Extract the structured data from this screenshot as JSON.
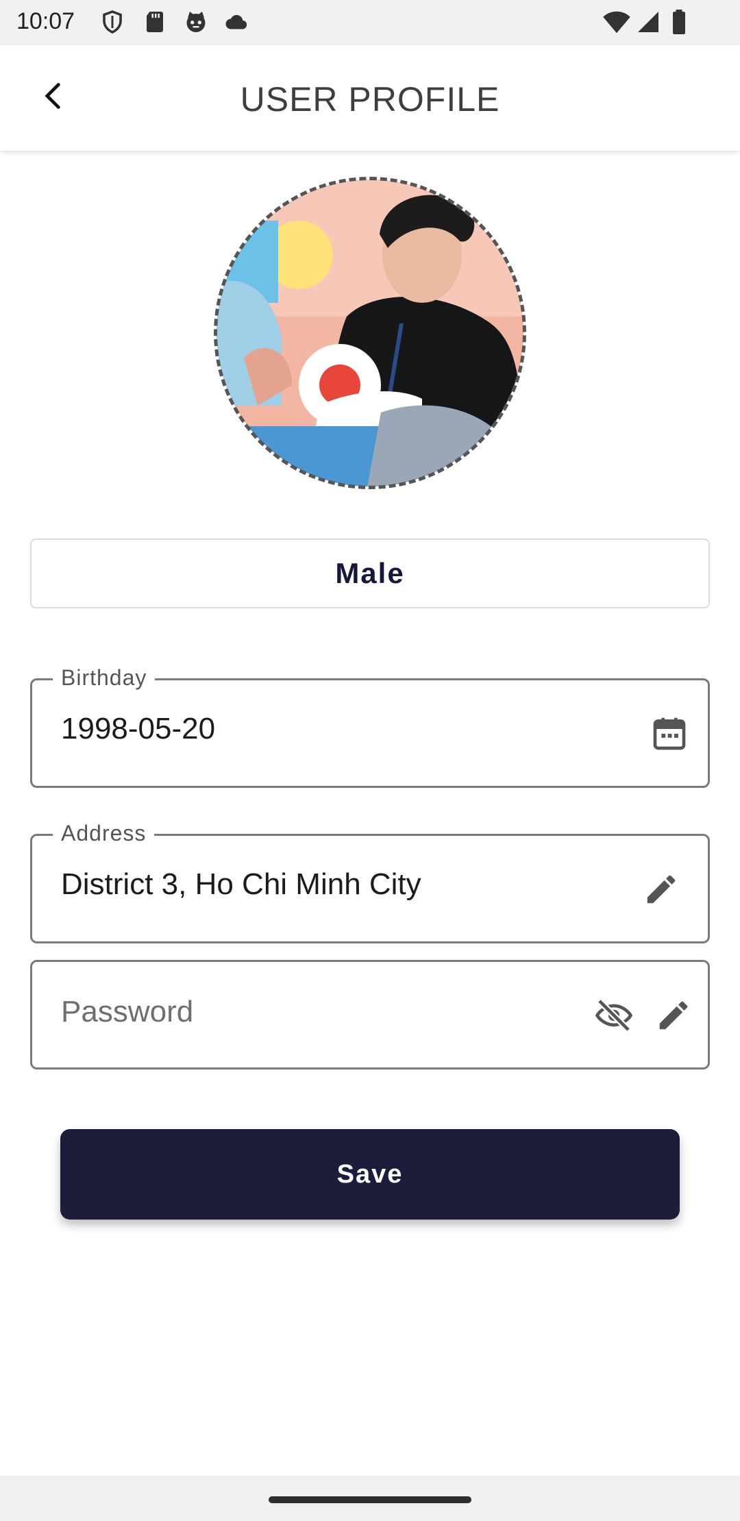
{
  "status_bar": {
    "time": "10:07",
    "left_icons": [
      "shield-icon",
      "sd-card-icon",
      "cat-face-icon",
      "cloud-icon"
    ],
    "right_icons": [
      "wifi-icon",
      "signal-icon",
      "battery-icon"
    ]
  },
  "app_bar": {
    "title": "USER PROFILE",
    "back_icon": "chevron-left-icon"
  },
  "profile": {
    "gender": "Male"
  },
  "fields": {
    "birthday": {
      "label": "Birthday",
      "value": "1998-05-20",
      "icon": "calendar-icon"
    },
    "address": {
      "label": "Address",
      "value": "District 3, Ho Chi Minh City",
      "icon": "pencil-icon"
    },
    "password": {
      "placeholder": "Password",
      "icons": [
        "eye-off-icon",
        "pencil-icon"
      ]
    }
  },
  "actions": {
    "save_label": "Save"
  },
  "colors": {
    "primary": "#1b1d3a",
    "field_border": "#7a7a7a",
    "status_bar_bg": "#f1f1f1"
  }
}
